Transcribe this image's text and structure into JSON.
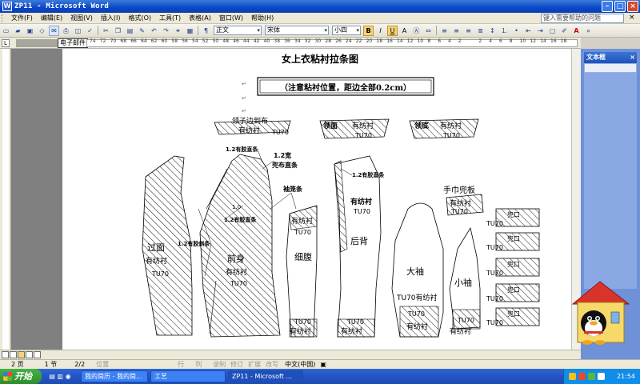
{
  "window": {
    "title": "ZP11 - Microsoft Word",
    "app_icon": "W"
  },
  "menu": {
    "items": [
      "文件(F)",
      "编辑(E)",
      "视图(V)",
      "插入(I)",
      "格式(O)",
      "工具(T)",
      "表格(A)",
      "窗口(W)",
      "帮助(H)"
    ],
    "help_placeholder": "键入需要帮助的问题",
    "close_glyph": "×"
  },
  "toolbar": {
    "style": "正文",
    "font": "宋体",
    "size": "小四",
    "bold": "B",
    "italic": "I",
    "underline": "U",
    "char_a": "A"
  },
  "ruler": {
    "tag": "电子邮件",
    "ticks": [
      "74",
      "72",
      "70",
      "68",
      "66",
      "64",
      "62",
      "60",
      "58",
      "56",
      "54",
      "52",
      "50",
      "48",
      "46",
      "44",
      "42",
      "40",
      "38",
      "36",
      "34",
      "32",
      "30",
      "28",
      "26",
      "24",
      "22",
      "20",
      "18",
      "16",
      "14",
      "12",
      "10",
      "8",
      "6",
      "4",
      "2",
      "",
      "2",
      "4",
      "6",
      "8",
      "10",
      "12",
      "14",
      "16",
      "18"
    ]
  },
  "document": {
    "title": "女上衣粘衬拉条图",
    "subtitle": "（注意粘衬位置，距边全部0.2cm）",
    "pieces": {
      "collar_stand": [
        "领子边到布",
        "有纺衬",
        "TU70"
      ],
      "collar_face": [
        "领面",
        "有纺衬",
        "TU70"
      ],
      "collar_under": [
        "领底",
        "有纺衬",
        "TU70"
      ],
      "side_front": [
        "过面",
        "有纺衬",
        "TU70"
      ],
      "front": [
        "前身",
        "有纺衬",
        "TU70"
      ],
      "side_panel": [
        "细腹",
        "TU70",
        "有纺衬"
      ],
      "side_top": [
        "有纺衬",
        "TU70"
      ],
      "back": [
        "后背",
        "有纺衬",
        "TU70"
      ],
      "upper_sleeve": [
        "大袖"
      ],
      "upper_sleeve_hem": [
        "TU70有纺衬",
        "TU70",
        "有纺衬"
      ],
      "under_sleeve": [
        "小袖"
      ],
      "under_sleeve_hem": [
        "TU70",
        "有纺衬"
      ],
      "flap": [
        "手巾兜板",
        "有纺衬",
        "TU70"
      ],
      "pocket_piece": [
        "兜口",
        "TU70"
      ]
    },
    "annotations": {
      "a1": "1.2有胶直条",
      "a2": "1.2宽",
      "a3": "兜布直条",
      "a4": "1.2有胶直条",
      "a5": "1.2有胶直条",
      "a6": "1.2有胶斜条",
      "a7": "1.0",
      "a8": "袖笼条",
      "a9": "1.2有胶斜条"
    }
  },
  "pane": {
    "title": "文本框",
    "close_glyph": "×"
  },
  "status": {
    "page": "2 页",
    "section": "1 节",
    "pages": "2/2",
    "position": "位置",
    "row": "行",
    "col": "列",
    "rec": "录制",
    "trk": "修订",
    "ext": "扩展",
    "ovr": "改写",
    "lang": "中文(中国)"
  },
  "taskbar": {
    "start": "开始",
    "tasks": [
      "我的简历 - 我的简...",
      "工艺",
      "ZP11 - Microsoft ..."
    ],
    "clock": "21:54"
  },
  "colors": {
    "titlebar": "#0a47c8",
    "taskbar": "#2457c8",
    "start": "#2c8c2c",
    "pane": "#6e91d8",
    "highlight": "#f3d37a"
  }
}
